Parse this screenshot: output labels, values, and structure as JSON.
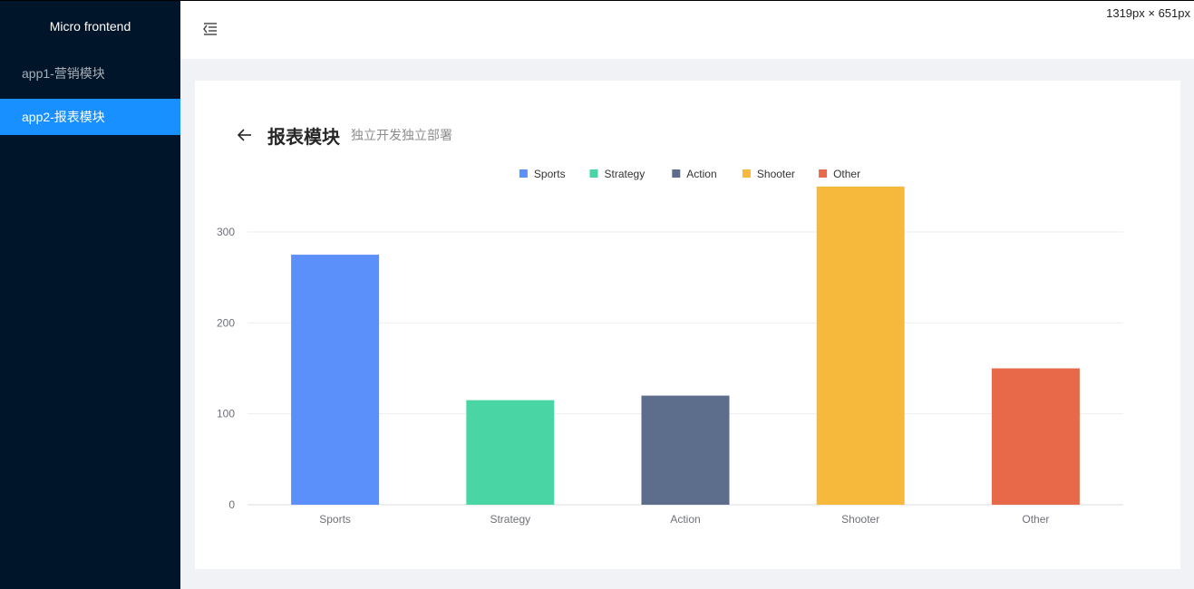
{
  "sidebar": {
    "brand": "Micro frontend",
    "items": [
      {
        "label": "app1-营销模块",
        "active": false
      },
      {
        "label": "app2-报表模块",
        "active": true
      }
    ]
  },
  "header": {
    "fold_icon": "menu-fold-icon",
    "dimensions_label": "1319px × 651px"
  },
  "page": {
    "back_icon": "arrow-left-icon",
    "title": "报表模块",
    "subtitle": "独立开发独立部署"
  },
  "colors": {
    "sidebar_bg": "#001529",
    "accent": "#1890ff"
  },
  "chart_data": {
    "type": "bar",
    "categories": [
      "Sports",
      "Strategy",
      "Action",
      "Shooter",
      "Other"
    ],
    "values": [
      275,
      115,
      120,
      350,
      150
    ],
    "colors": [
      "#5b8ff9",
      "#49d6a4",
      "#5d6e8c",
      "#f6b93b",
      "#e8684a"
    ],
    "legend": [
      "Sports",
      "Strategy",
      "Action",
      "Shooter",
      "Other"
    ],
    "legend_position": "top-center",
    "yticks": [
      0,
      100,
      200,
      300
    ],
    "ylim": [
      0,
      350
    ],
    "grid": true,
    "title": "",
    "xlabel": "",
    "ylabel": ""
  }
}
